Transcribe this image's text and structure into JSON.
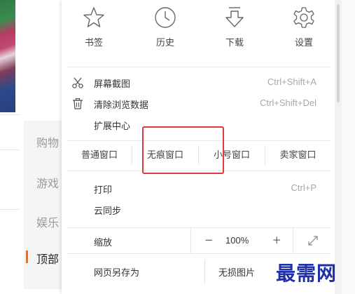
{
  "background": {
    "nav_items": [
      {
        "label": "购物",
        "active": false
      },
      {
        "label": "游戏",
        "active": false
      },
      {
        "label": "娱乐",
        "active": false
      },
      {
        "label": "顶部",
        "active": true
      }
    ],
    "active_marker_color": "#ff6a00"
  },
  "menu": {
    "top_items": [
      {
        "label": "书签",
        "icon": "star-icon"
      },
      {
        "label": "历史",
        "icon": "clock-icon"
      },
      {
        "label": "下载",
        "icon": "download-icon"
      },
      {
        "label": "设置",
        "icon": "gear-icon"
      }
    ],
    "tools": [
      {
        "label": "屏幕截图",
        "shortcut": "Ctrl+Shift+A",
        "icon": "scissors-icon"
      },
      {
        "label": "清除浏览数据",
        "shortcut": "Ctrl+Shift+Del",
        "icon": "trash-icon"
      },
      {
        "label": "扩展中心",
        "shortcut": "",
        "icon": ""
      }
    ],
    "windows": [
      "普通窗口",
      "无痕窗口",
      "小号窗口",
      "卖家窗口"
    ],
    "misc": [
      {
        "label": "打印",
        "shortcut": "Ctrl+P"
      },
      {
        "label": "云同步",
        "shortcut": ""
      }
    ],
    "zoom": {
      "label": "缩放",
      "minus": "−",
      "value": "100%",
      "plus": "+",
      "fullscreen_icon": "expand-icon"
    },
    "save_page": {
      "label": "网页另存为",
      "action": "无损图片"
    },
    "highlight": {
      "target": "无痕窗口",
      "color": "#e03a3a"
    }
  },
  "watermark": {
    "text": "最需网",
    "color": "#1f2fa8"
  }
}
